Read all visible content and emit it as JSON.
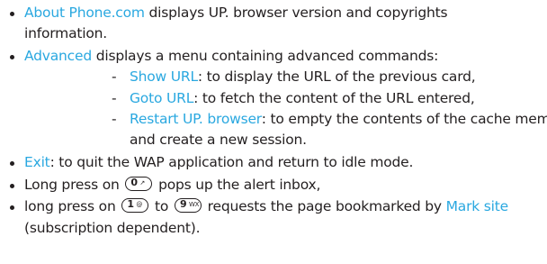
{
  "lines": {
    "l1_link": "About Phone.com",
    "l1_text": " displays UP. browser version and copyrights",
    "l2_text": "information.",
    "l3_link": "Advanced",
    "l3_text": " displays a menu containing advanced commands:",
    "l4_link": "Show URL",
    "l4_text": ": to display the URL of the previous card,",
    "l5_link": "Goto URL",
    "l5_text": ": to fetch the content of the URL entered,",
    "l6_link": "Restart UP. browser",
    "l6_text": ": to empty the contents of the cache memory",
    "l7_text": "and create a new session.",
    "l8_link": "Exit",
    "l8_text": ": to quit the WAP application and return to idle mode.",
    "l9_pre": "Long press on ",
    "l9_post": " pops up the alert inbox,",
    "l10_pre": "long press on ",
    "l10_mid": " to ",
    "l10_post": " requests the page bookmarked by ",
    "l10_link": "Mark site",
    "l11_text": "(subscription dependent)."
  },
  "keys": {
    "key0_main": "0",
    "key0_sub": "↗",
    "key1_main": "1",
    "key1_sub": "@",
    "key9_main": "9",
    "key9_sub": "WX"
  },
  "colors": {
    "text": "#231f20",
    "link": "#2aa8e0"
  }
}
